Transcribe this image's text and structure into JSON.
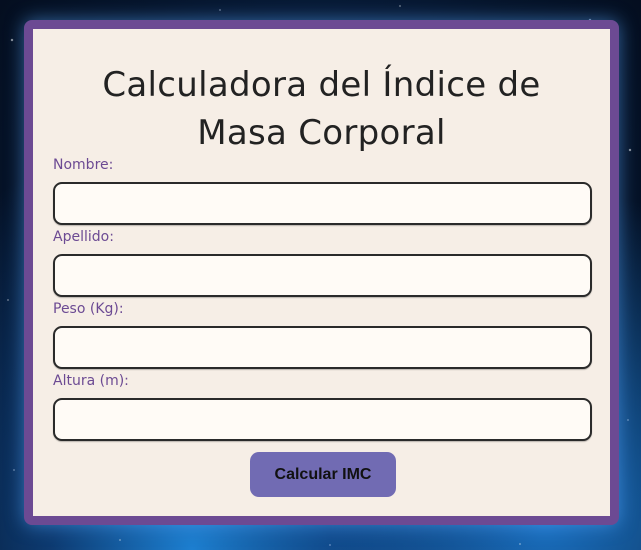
{
  "title_line1": "Calculadora del Índice de",
  "title_line2": "Masa Corporal",
  "fields": [
    {
      "label": "Nombre:",
      "value": "",
      "placeholder": ""
    },
    {
      "label": "Apellido:",
      "value": "",
      "placeholder": ""
    },
    {
      "label": "Peso (Kg):",
      "value": "",
      "placeholder": ""
    },
    {
      "label": "Altura (m):",
      "value": "",
      "placeholder": ""
    }
  ],
  "button_label": "Calcular IMC",
  "colors": {
    "card_border": "#6c4a93",
    "card_background": "#f6eee6",
    "label_text": "#6c4a93",
    "button_background": "#716bb3"
  }
}
